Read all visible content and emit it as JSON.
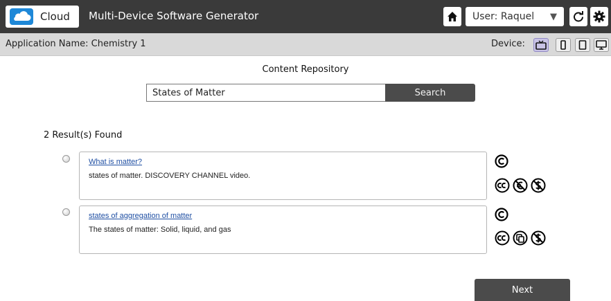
{
  "header": {
    "brand_label": "Cloud",
    "app_title": "Multi-Device Software Generator",
    "user_label": "User: Raquel",
    "icons": [
      "cloud-icon",
      "home-icon",
      "chevron-down-icon",
      "refresh-icon",
      "gear-icon"
    ]
  },
  "subheader": {
    "app_name_label": "Application Name:",
    "app_name_value": "Chemistry 1",
    "device_label": "Device:",
    "devices": [
      "tv",
      "phone",
      "tablet",
      "desktop"
    ],
    "active_device": "tv"
  },
  "repository": {
    "title": "Content Repository",
    "search_value": "States of Matter",
    "search_button": "Search",
    "results_count": "2 Result(s) Found"
  },
  "results": [
    {
      "title": "What is matter?",
      "description": "states of matter. DISCOVERY CHANNEL video.",
      "licenses": [
        "copyright-icon",
        "cc-icon",
        "noncommercial-euro-icon",
        "noncommercial-icon"
      ]
    },
    {
      "title": "states of aggregation of matter",
      "description": "The states of matter: Solid, liquid, and gas",
      "licenses": [
        "copyright-icon",
        "cc-icon",
        "sharealike-icon",
        "noncommercial-icon"
      ]
    }
  ],
  "footer": {
    "next_label": "Next"
  },
  "colors": {
    "topbar": "#3a3a3a",
    "subbar": "#d9d9d9",
    "button": "#4b4b4b",
    "link": "#1f4fa3",
    "active_device": "#c9c3e6"
  }
}
